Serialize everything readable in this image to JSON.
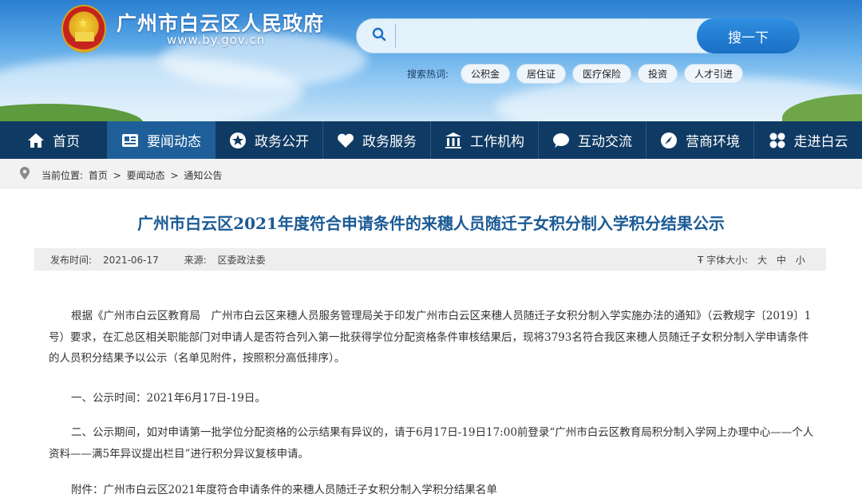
{
  "site": {
    "title": "广州市白云区人民政府",
    "url": "www.by.gov.cn"
  },
  "search": {
    "placeholder": "",
    "button_label": "搜一下",
    "hot_label": "搜索热词:",
    "hot_words": [
      "公积金",
      "居住证",
      "医疗保险",
      "投资",
      "人才引进"
    ]
  },
  "nav": {
    "items": [
      {
        "label": "首页",
        "icon": "home-icon"
      },
      {
        "label": "要闻动态",
        "icon": "news-icon"
      },
      {
        "label": "政务公开",
        "icon": "star-icon"
      },
      {
        "label": "政务服务",
        "icon": "heart-icon"
      },
      {
        "label": "工作机构",
        "icon": "building-icon"
      },
      {
        "label": "互动交流",
        "icon": "chat-icon"
      },
      {
        "label": "营商环境",
        "icon": "compass-icon"
      },
      {
        "label": "走进白云",
        "icon": "grid-icon"
      }
    ],
    "active_index": 1
  },
  "breadcrumb": {
    "prefix": "当前位置:",
    "items": [
      "首页",
      "要闻动态",
      "通知公告"
    ],
    "separator": ">"
  },
  "article": {
    "title": "广州市白云区2021年度符合申请条件的来穗人员随迁子女积分制入学积分结果公示",
    "publish_label": "发布时间:",
    "publish_date": "2021-06-17",
    "source_label": "来源:",
    "source": "区委政法委",
    "font_size_label": "字体大小:",
    "font_sizes": [
      "大",
      "中",
      "小"
    ],
    "paragraphs": [
      "根据《广州市白云区教育局　广州市白云区来穗人员服务管理局关于印发广州市白云区来穗人员随迁子女积分制入学实施办法的通知》（云教规字〔2019〕1号）要求，在汇总区相关职能部门对申请人是否符合列入第一批获得学位分配资格条件审核结果后，现将3793名符合我区来穗人员随迁子女积分制入学申请条件的人员积分结果予以公示（名单见附件，按照积分高低排序）。",
      "一、公示时间：2021年6月17日-19日。",
      "二、公示期间，如对申请第一批学位分配资格的公示结果有异议的，请于6月17日-19日17:00前登录“广州市白云区教育局积分制入学网上办理中心——个人资料——满5年异议提出栏目”进行积分异议复核申请。",
      "附件：广州市白云区2021年度符合申请条件的来穗人员随迁子女积分制入学积分结果名单"
    ]
  },
  "colors": {
    "nav_bg": "#0f3a63",
    "nav_active": "#1f5f99",
    "title_blue": "#1b5a95",
    "search_button": "#1a6fc4"
  }
}
